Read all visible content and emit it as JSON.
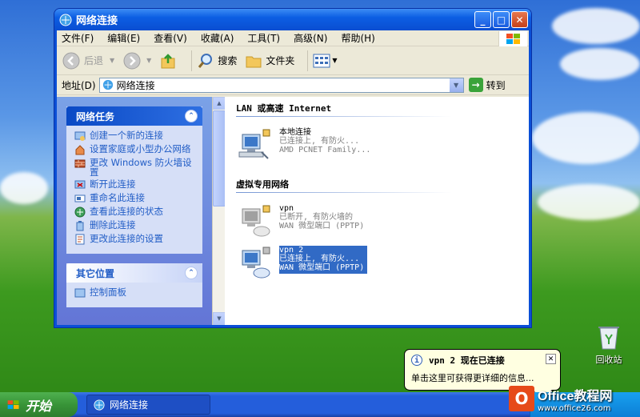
{
  "window": {
    "title": "网络连接",
    "menus": [
      "文件(F)",
      "编辑(E)",
      "查看(V)",
      "收藏(A)",
      "工具(T)",
      "高级(N)",
      "帮助(H)"
    ],
    "toolbar": {
      "back": "后退",
      "search": "搜索",
      "folders": "文件夹"
    },
    "address": {
      "label": "地址(D)",
      "value": "网络连接",
      "go": "转到"
    }
  },
  "left_pane": {
    "network_tasks": {
      "title": "网络任务",
      "items": [
        "创建一个新的连接",
        "设置家庭或小型办公网络",
        "更改 Windows 防火墙设置",
        "断开此连接",
        "重命名此连接",
        "查看此连接的状态",
        "删除此连接",
        "更改此连接的设置"
      ]
    },
    "other_places": {
      "title": "其它位置",
      "partial_item": "控制面板"
    }
  },
  "right_pane": {
    "groups": [
      {
        "title": "LAN 或高速 Internet",
        "items": [
          {
            "name": "本地连接",
            "status": "已连接上, 有防火...",
            "device": "AMD PCNET Family..."
          }
        ]
      },
      {
        "title": "虚拟专用网络",
        "items": [
          {
            "name": "vpn",
            "status": "已断开, 有防火墙的",
            "device": "WAN 微型端口 (PPTP)"
          },
          {
            "name": "vpn 2",
            "status": "已连接上, 有防火...",
            "device": "WAN 微型端口 (PPTP)"
          }
        ]
      }
    ]
  },
  "balloon": {
    "title": "vpn 2 现在已连接",
    "message": "单击这里可获得更详细的信息..."
  },
  "desktop": {
    "recycle_bin": "回收站"
  },
  "taskbar": {
    "start": "开始",
    "task": "网络连接"
  },
  "watermark": {
    "brand": "Office教程网",
    "url": "www.office26.com"
  }
}
